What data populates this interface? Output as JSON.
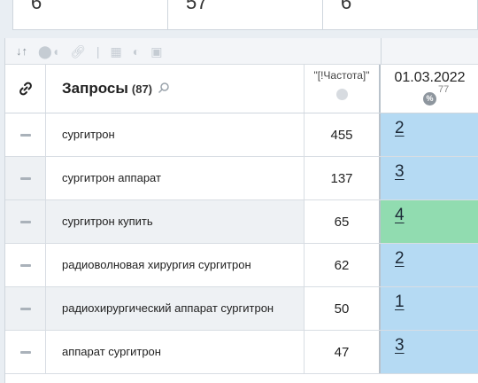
{
  "top_cards": [
    "6",
    "57",
    "6"
  ],
  "toolbar": {
    "sort_icon": "sort-icon",
    "icons": [
      "toggle-icon",
      "link-icon",
      "separator-icon",
      "calculator-icon",
      "contrast-icon",
      "text-icon"
    ]
  },
  "header": {
    "link_icon": "link-icon",
    "query_title": "Запросы",
    "query_count": "(87)",
    "search_icon": "search-icon",
    "freq_label": "\"[!Частота]\"",
    "date_label": "01.03.2022",
    "percent_badge": "%",
    "date_count": "77"
  },
  "rows": [
    {
      "query": "сургитрон",
      "freq": "455",
      "position": "2",
      "color": "#b5daf3"
    },
    {
      "query": "сургитрон аппарат",
      "freq": "137",
      "position": "3",
      "color": "#b5daf3"
    },
    {
      "query": "сургитрон купить",
      "freq": "65",
      "position": "4",
      "color": "#91dcb0"
    },
    {
      "query": "радиоволновая хирургия сургитрон",
      "freq": "62",
      "position": "2",
      "color": "#b5daf3"
    },
    {
      "query": "радиохирургический аппарат сургитрон",
      "freq": "50",
      "position": "1",
      "color": "#b5daf3"
    },
    {
      "query": "аппарат сургитрон",
      "freq": "47",
      "position": "3",
      "color": "#b5daf3"
    }
  ]
}
